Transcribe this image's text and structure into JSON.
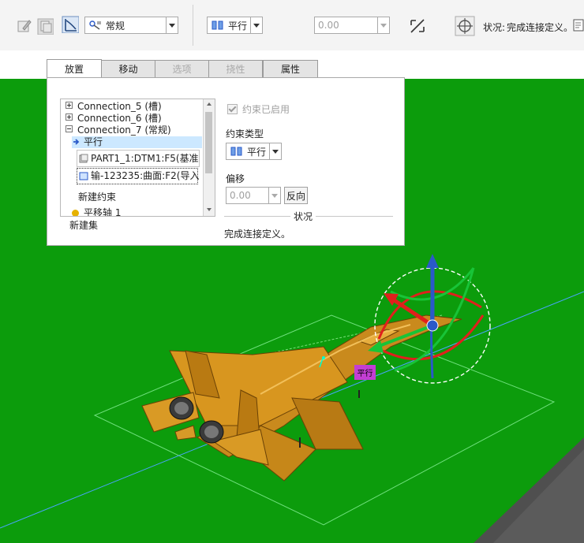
{
  "toolbar": {
    "mode_dropdown": {
      "value": "常规"
    },
    "constraint_dropdown": {
      "value": "平行"
    },
    "offset_input": {
      "value": "0.00"
    },
    "status": {
      "label": "状况:",
      "text": "完成连接定义。"
    }
  },
  "tabs": [
    {
      "label": "放置",
      "state": "active"
    },
    {
      "label": "移动",
      "state": "normal"
    },
    {
      "label": "选项",
      "state": "disabled"
    },
    {
      "label": "挠性",
      "state": "disabled"
    },
    {
      "label": "属性",
      "state": "normal"
    }
  ],
  "panel": {
    "tree": {
      "items": [
        {
          "label": "Connection_5 (槽)",
          "expander": "plus"
        },
        {
          "label": "Connection_6 (槽)",
          "expander": "plus"
        },
        {
          "label": "Connection_7 (常规)",
          "expander": "minus"
        },
        {
          "label": "平行",
          "selected": true
        },
        {
          "label": "PART1_1:DTM1:F5(基准"
        },
        {
          "label": "输-123235:曲面:F2(导入"
        },
        {
          "label": "新建约束"
        },
        {
          "label": "平移轴 1"
        },
        {
          "label": "新建集"
        }
      ]
    },
    "constraint_enabled": {
      "label": "约束已启用",
      "checked": true
    },
    "constraint_type": {
      "label": "约束类型",
      "value": "平行"
    },
    "offset": {
      "label": "偏移",
      "value": "0.00",
      "flip_label": "反向"
    },
    "status": {
      "label": "状况",
      "text": "完成连接定义。"
    }
  },
  "viewport": {
    "badge_label": "平行",
    "background_color": "#0c9c0c"
  },
  "colors": {
    "accent_blue": "#2a59c8",
    "selection": "#cce8ff",
    "aircraft": "#c98a1d"
  }
}
